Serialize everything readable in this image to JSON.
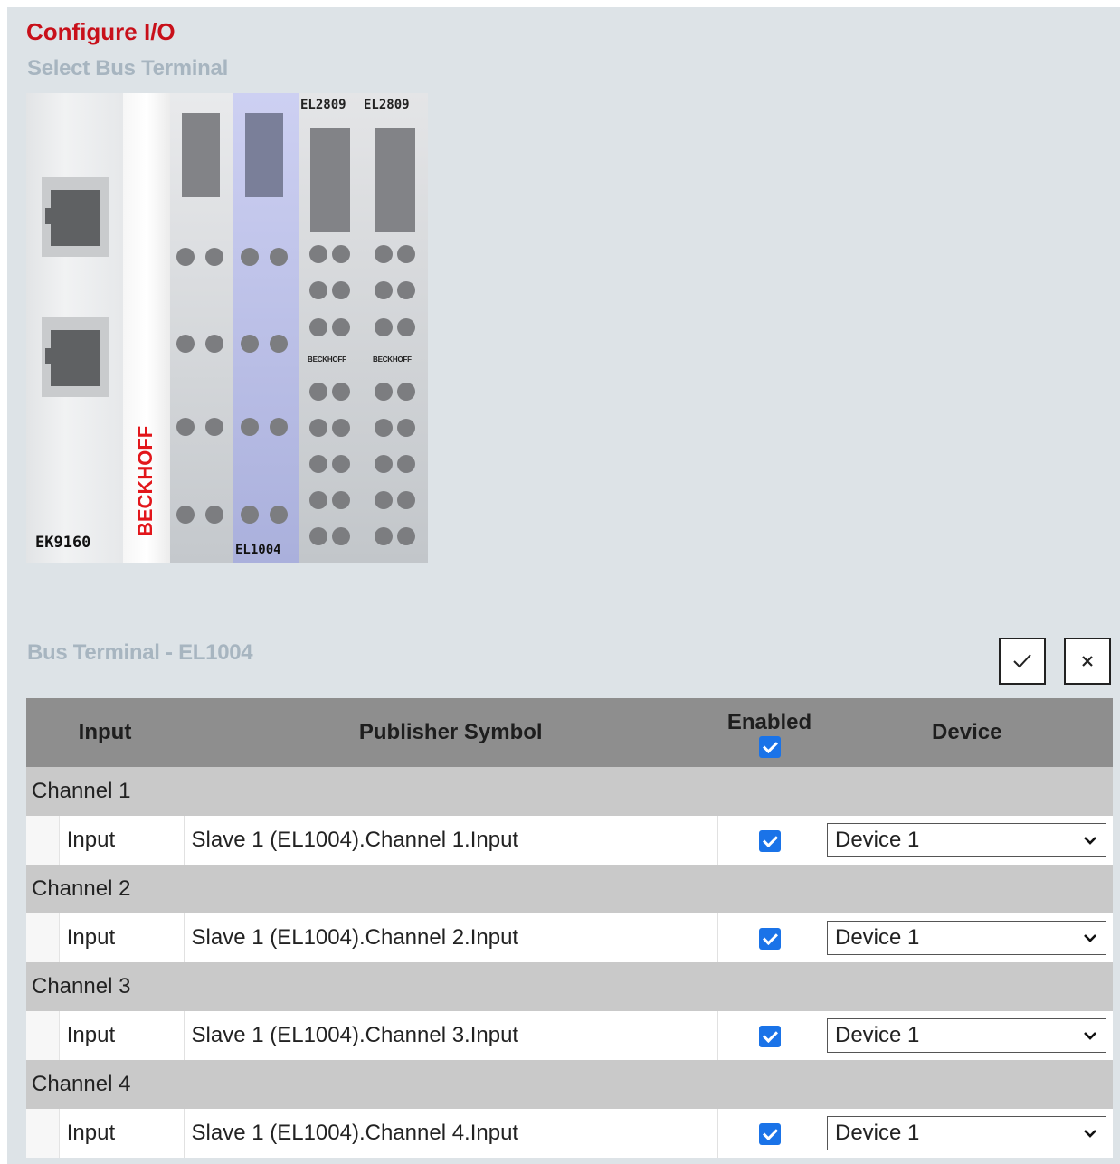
{
  "title": "Configure I/O",
  "select_heading": "Select Bus Terminal",
  "terminals": {
    "coupler_label": "EK9160",
    "logo_text": "BECKHOFF",
    "selected_label": "EL1004",
    "top_labels": [
      "EL2809",
      "EL2809"
    ],
    "small_brand": "BECKHOFF"
  },
  "bus_terminal_heading": "Bus Terminal - EL1004",
  "actions": {
    "confirm_icon": "check-icon",
    "cancel_icon": "close-icon"
  },
  "table": {
    "headers": {
      "input": "Input",
      "publisher": "Publisher Symbol",
      "enabled": "Enabled",
      "device": "Device"
    },
    "header_enabled_checked": true,
    "channels": [
      {
        "name": "Channel 1",
        "input": "Input",
        "symbol": "Slave 1 (EL1004).Channel 1.Input",
        "enabled": true,
        "device": "Device 1"
      },
      {
        "name": "Channel 2",
        "input": "Input",
        "symbol": "Slave 1 (EL1004).Channel 2.Input",
        "enabled": true,
        "device": "Device 1"
      },
      {
        "name": "Channel 3",
        "input": "Input",
        "symbol": "Slave 1 (EL1004).Channel 3.Input",
        "enabled": true,
        "device": "Device 1"
      },
      {
        "name": "Channel 4",
        "input": "Input",
        "symbol": "Slave 1 (EL1004).Channel 4.Input",
        "enabled": true,
        "device": "Device 1"
      }
    ]
  },
  "colors": {
    "title": "#c8101a",
    "heading": "#a7b5c0",
    "checkbox": "#1a73e8",
    "selected_terminal": "#c3c8ee"
  }
}
